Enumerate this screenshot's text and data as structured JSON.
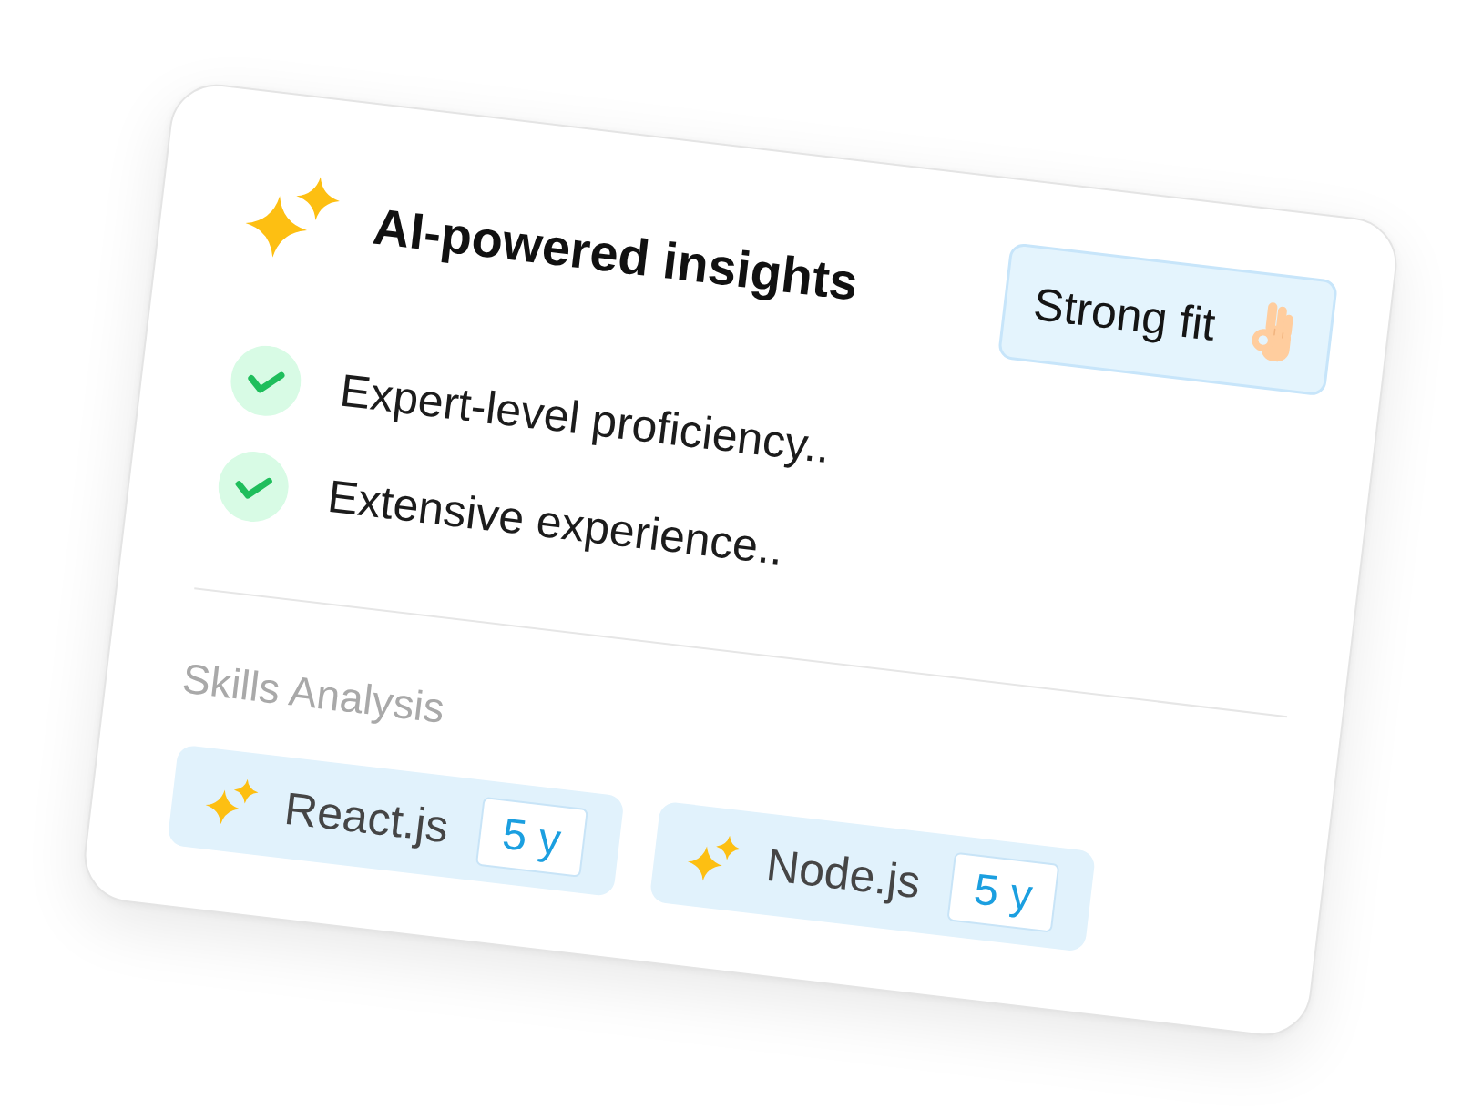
{
  "header": {
    "title": "AI-powered insights",
    "badge": {
      "label": "Strong fit"
    }
  },
  "insights": [
    {
      "text": "Expert-level proficiency..",
      "checked": true
    },
    {
      "text": "Extensive experience..",
      "checked": true
    }
  ],
  "skills": {
    "title": "Skills Analysis",
    "items": [
      {
        "name": "React.js",
        "years": "5 y"
      },
      {
        "name": "Node.js",
        "years": "5 y"
      }
    ]
  }
}
